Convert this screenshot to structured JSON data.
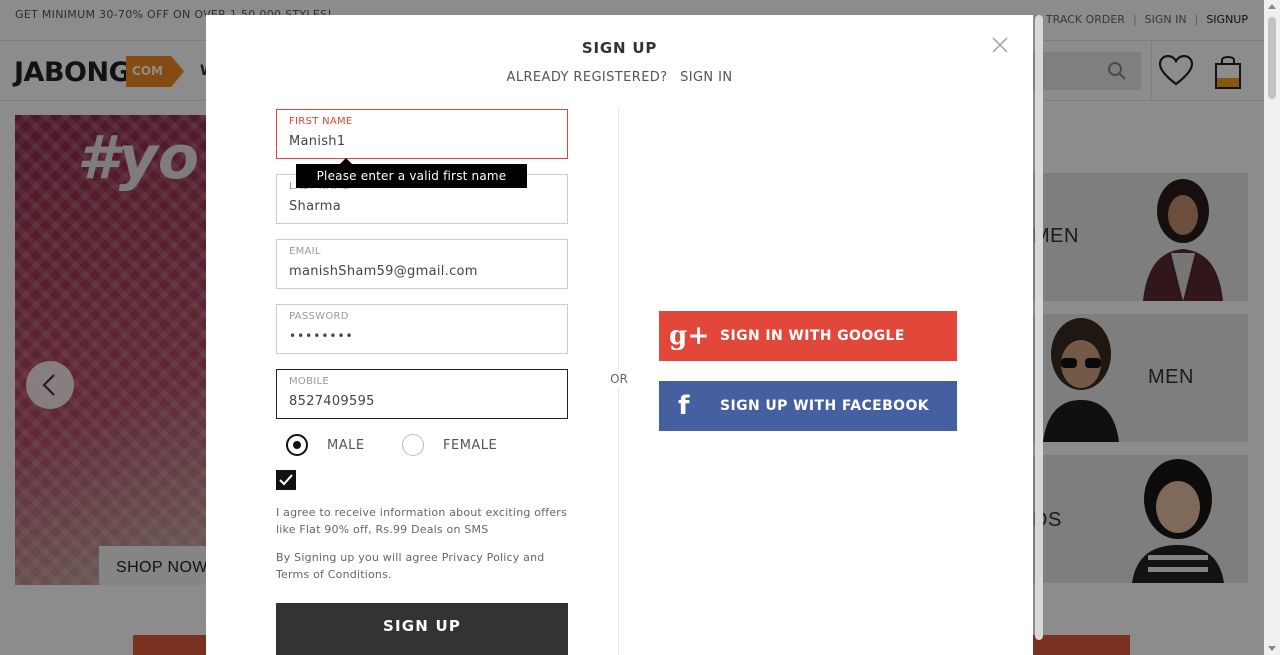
{
  "topbar": {
    "promo": "GET MINIMUM 30-70% OFF ON OVER 1,50,000 STYLES!",
    "links": [
      "TRACK ORDER",
      "SIGN IN",
      "SIGNUP"
    ]
  },
  "header": {
    "logo": "JABONG",
    "logo_suffix": "COM",
    "nav_fragment": "W"
  },
  "banner": {
    "text": "#yo",
    "shop_now": "SHOP NOW"
  },
  "categories": [
    "MEN",
    "MEN",
    "DS"
  ],
  "modal": {
    "title": "SIGN UP",
    "already_registered": "ALREADY REGISTERED?",
    "sign_in_link": "SIGN IN",
    "fields": {
      "first_name": {
        "label": "FIRST NAME",
        "value": "Manish1"
      },
      "last_name": {
        "label": "LAST NAME",
        "value": "Sharma"
      },
      "email": {
        "label": "EMAIL",
        "value": "manishSham59@gmail.com"
      },
      "password": {
        "label": "PASSWORD",
        "value": "••••••••"
      },
      "mobile": {
        "label": "MOBILE",
        "value": "8527409595"
      }
    },
    "error_tooltip": "Please enter a valid first name",
    "gender": {
      "male": "MALE",
      "female": "FEMALE",
      "selected": "MALE"
    },
    "sms_consent": "I agree to receive information about exciting offers like Flat 90% off, Rs.99 Deals on SMS",
    "terms": "By Signing up you will agree Privacy Policy and Terms of Conditions.",
    "submit": "SIGN UP",
    "or": "OR",
    "google": "SIGN IN WITH GOOGLE",
    "facebook": "SIGN UP WITH FACEBOOK",
    "google_icon": "g+",
    "facebook_icon": "f"
  },
  "colors": {
    "accent_orange": "#f08a24",
    "error_red": "#e0452d",
    "google": "#e2483a",
    "facebook": "#4460a0",
    "submit": "#333333"
  }
}
